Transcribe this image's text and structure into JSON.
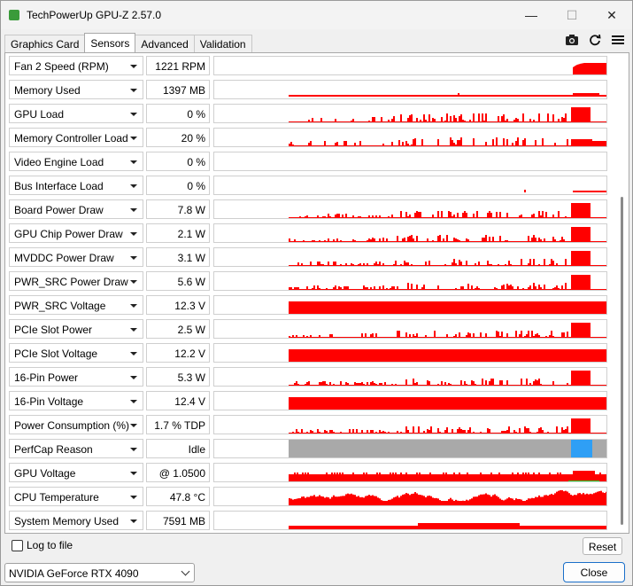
{
  "window": {
    "title": "TechPowerUp GPU-Z 2.57.0",
    "controls": {
      "minimize": "—",
      "maximize": "☐",
      "close": "✕"
    }
  },
  "tabs": [
    {
      "label": "Graphics Card",
      "active": false
    },
    {
      "label": "Sensors",
      "active": true
    },
    {
      "label": "Advanced",
      "active": false
    },
    {
      "label": "Validation",
      "active": false
    }
  ],
  "toolbar": {
    "icons": [
      "camera-icon",
      "refresh-icon",
      "menu-icon"
    ]
  },
  "graph_colors": {
    "red": "#ff0000",
    "gray": "#a9a9a9",
    "blue": "#2f9ff5",
    "green": "#22cc22"
  },
  "sensors": [
    {
      "name": "Fan 2 Speed (RPM)",
      "value": "1221 RPM",
      "graph": "fan"
    },
    {
      "name": "Memory Used",
      "value": "1397 MB",
      "graph": "mem"
    },
    {
      "name": "GPU Load",
      "value": "0 %",
      "graph": "load"
    },
    {
      "name": "Memory Controller Load",
      "value": "20 %",
      "graph": "mcload"
    },
    {
      "name": "Video Engine Load",
      "value": "0 %",
      "graph": "none"
    },
    {
      "name": "Bus Interface Load",
      "value": "0 %",
      "graph": "bus"
    },
    {
      "name": "Board Power Draw",
      "value": "7.8 W",
      "graph": "power"
    },
    {
      "name": "GPU Chip Power Draw",
      "value": "2.1 W",
      "graph": "power"
    },
    {
      "name": "MVDDC Power Draw",
      "value": "3.1 W",
      "graph": "power"
    },
    {
      "name": "PWR_SRC Power Draw",
      "value": "5.6 W",
      "graph": "power"
    },
    {
      "name": "PWR_SRC Voltage",
      "value": "12.3 V",
      "graph": "full"
    },
    {
      "name": "PCIe Slot Power",
      "value": "2.5 W",
      "graph": "power"
    },
    {
      "name": "PCIe Slot Voltage",
      "value": "12.2 V",
      "graph": "full"
    },
    {
      "name": "16-Pin Power",
      "value": "5.3 W",
      "graph": "power"
    },
    {
      "name": "16-Pin Voltage",
      "value": "12.4 V",
      "graph": "full"
    },
    {
      "name": "Power Consumption (%)",
      "value": "1.7 % TDP",
      "graph": "power"
    },
    {
      "name": "PerfCap Reason",
      "value": "Idle",
      "graph": "perfcap"
    },
    {
      "name": "GPU Voltage",
      "value": "@ 1.0500",
      "graph": "voltage"
    },
    {
      "name": "CPU Temperature",
      "value": "47.8 °C",
      "graph": "cputemp"
    },
    {
      "name": "System Memory Used",
      "value": "7591 MB",
      "graph": "sysmem"
    }
  ],
  "footer": {
    "log_label": "Log to file",
    "log_checked": false,
    "reset_label": "Reset",
    "gpu_selected": "NVIDIA GeForce RTX 4090",
    "close_label": "Close"
  }
}
